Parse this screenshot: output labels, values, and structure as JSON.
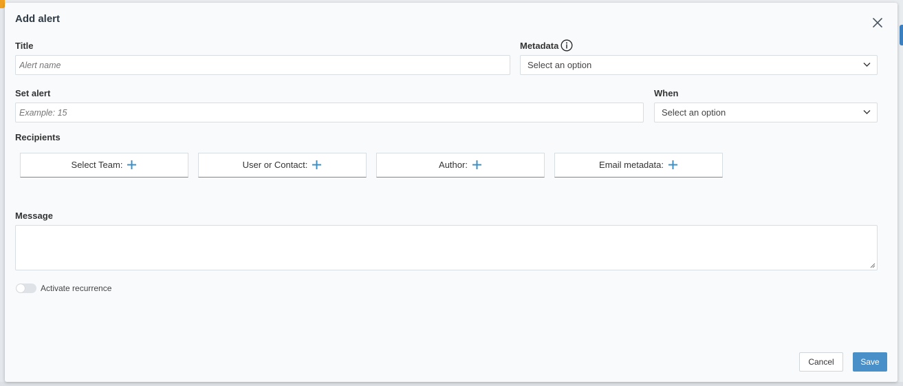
{
  "dialog": {
    "title": "Add alert",
    "fields": {
      "title": {
        "label": "Title",
        "placeholder": "Alert name",
        "value": ""
      },
      "metadata": {
        "label": "Metadata",
        "selected": "Select an option"
      },
      "set_alert": {
        "label": "Set alert",
        "placeholder": "Example: 15",
        "value": ""
      },
      "when": {
        "label": "When",
        "selected": "Select an option"
      }
    },
    "recipients": {
      "label": "Recipients",
      "buttons": [
        {
          "label": "Select Team:"
        },
        {
          "label": "User or Contact:"
        },
        {
          "label": "Author:"
        },
        {
          "label": "Email metadata:"
        }
      ]
    },
    "message": {
      "label": "Message",
      "value": ""
    },
    "recurrence": {
      "label": "Activate recurrence",
      "enabled": false
    },
    "actions": {
      "cancel": "Cancel",
      "save": "Save"
    }
  },
  "colors": {
    "accent": "#4a90c8",
    "plus_icon": "#3d8fc6",
    "dialog_bg": "#f8fafc"
  }
}
